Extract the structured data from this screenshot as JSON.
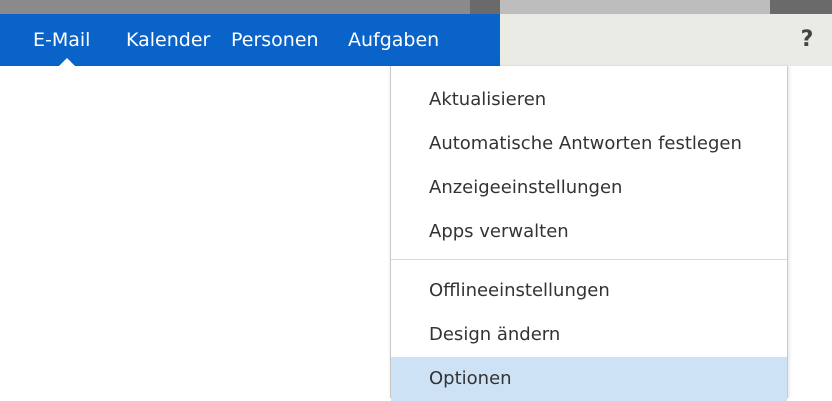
{
  "nav": {
    "tabs": [
      {
        "label": "E-Mail",
        "active": true
      },
      {
        "label": "Kalender",
        "active": false
      },
      {
        "label": "Personen",
        "active": false
      },
      {
        "label": "Aufgaben",
        "active": false
      }
    ],
    "help_label": "?"
  },
  "settings_menu": {
    "items": [
      {
        "label": "Aktualisieren"
      },
      {
        "label": "Automatische Antworten festlegen"
      },
      {
        "label": "Anzeigeeinstellungen"
      },
      {
        "label": "Apps verwalten"
      },
      {
        "label": "Offlineeinstellungen"
      },
      {
        "label": "Design ändern"
      },
      {
        "label": "Optionen",
        "highlighted": true
      }
    ]
  },
  "colors": {
    "nav_background": "#0a63c9",
    "highlight_background": "#cde3f5"
  }
}
